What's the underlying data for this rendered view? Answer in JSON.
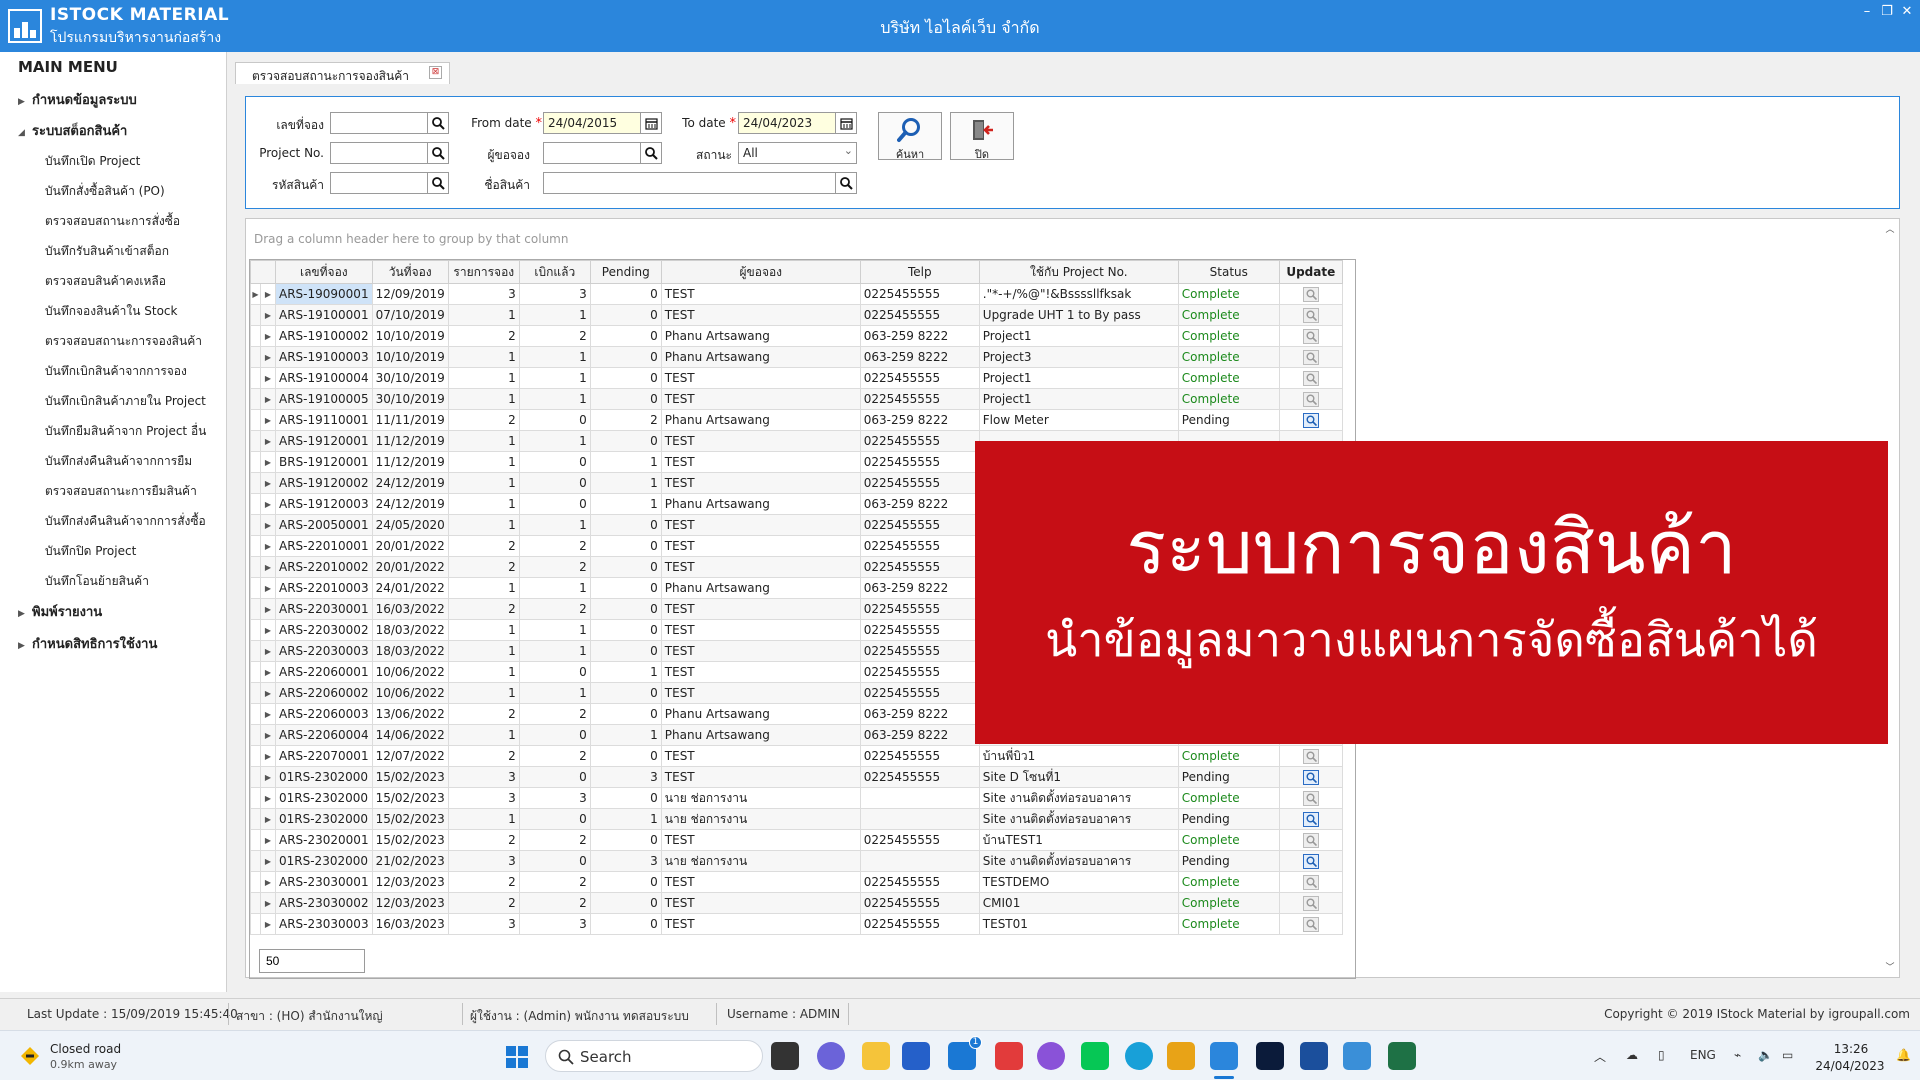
{
  "app": {
    "logo_name": "ISTOCK MATERIAL",
    "logo_subtitle": "โปรแกรมบริหารงานก่อสร้าง",
    "company": "บริษัท ไอไลค์เว็บ จำกัด",
    "win_min": "–",
    "win_restore": "❐",
    "win_close": "✕",
    "brand_color": "#2b86dc"
  },
  "sidebar": {
    "title": "MAIN MENU",
    "groups": [
      {
        "label": "กำหนดข้อมูลระบบ",
        "caret": "▶"
      },
      {
        "label": "ระบบสต็อกสินค้า",
        "caret": "◢"
      },
      {
        "label": "พิมพ์รายงาน",
        "caret": "▶"
      },
      {
        "label": "กำหนดสิทธิการใช้งาน",
        "caret": "▶"
      }
    ],
    "items": [
      "บันทึกเปิด Project",
      "บันทึกสั่งซื้อสินค้า (PO)",
      "ตรวจสอบสถานะการสั่งซื้อ",
      "บันทึกรับสินค้าเข้าสต็อก",
      "ตรวจสอบสินค้าคงเหลือ",
      "บันทึกจองสินค้าใน Stock",
      "ตรวจสอบสถานะการจองสินค้า",
      "บันทึกเบิกสินค้าจากการจอง",
      "บันทึกเบิกสินค้าภายใน Project",
      "บันทึกยืมสินค้าจาก Project อื่น",
      "บันทึกส่งคืนสินค้าจากการยืม",
      "ตรวจสอบสถานะการยืมสินค้า",
      "บันทึกส่งคืนสินค้าจากการสั่งซื้อ",
      "บันทึกปิด Project",
      "บันทึกโอนย้ายสินค้า"
    ]
  },
  "tab": {
    "label": "ตรวจสอบสถานะการจองสินค้า",
    "close": "⊠"
  },
  "filter": {
    "doc_no_label": "เลขที่จอง",
    "project_label": "Project No.",
    "product_code_label": "รหัสสินค้า",
    "from_date_label": "From date",
    "from_date_value": "24/04/2015",
    "to_date_label": "To date",
    "to_date_value": "24/04/2023",
    "requester_label": "ผู้ขอจอง",
    "product_name_label": "ชื่อสินค้า",
    "status_label": "สถานะ",
    "status_value": "All",
    "required_mark": "*",
    "search_label": "ค้นหา",
    "close_label": "ปิด"
  },
  "grid": {
    "group_hint": "Drag a column header here to group by that column",
    "columns": [
      "เลขที่จอง",
      "วันที่จอง",
      "รายการจอง",
      "เบิกแล้ว",
      "Pending",
      "ผู้ขอจอง",
      "Telp",
      "ใช้กับ Project No.",
      "Status",
      "Update"
    ],
    "current_row_marker": "▶",
    "expander": "▶",
    "rows": [
      {
        "doc": "ARS-19090001",
        "date": "12/09/2019",
        "items": "3",
        "issued": "3",
        "pending": "0",
        "req": "TEST",
        "tel": "0225455555",
        "proj": ".\"*-+/%@\"!&Bssssllfksak",
        "status": "Complete"
      },
      {
        "doc": "ARS-19100001",
        "date": "07/10/2019",
        "items": "1",
        "issued": "1",
        "pending": "0",
        "req": "TEST",
        "tel": "0225455555",
        "proj": "Upgrade UHT 1 to By pass",
        "status": "Complete"
      },
      {
        "doc": "ARS-19100002",
        "date": "10/10/2019",
        "items": "2",
        "issued": "2",
        "pending": "0",
        "req": "Phanu Artsawang",
        "tel": "063-259 8222",
        "proj": "Project1",
        "status": "Complete"
      },
      {
        "doc": "ARS-19100003",
        "date": "10/10/2019",
        "items": "1",
        "issued": "1",
        "pending": "0",
        "req": "Phanu Artsawang",
        "tel": "063-259 8222",
        "proj": "Project3",
        "status": "Complete"
      },
      {
        "doc": "ARS-19100004",
        "date": "30/10/2019",
        "items": "1",
        "issued": "1",
        "pending": "0",
        "req": "TEST",
        "tel": "0225455555",
        "proj": "Project1",
        "status": "Complete"
      },
      {
        "doc": "ARS-19100005",
        "date": "30/10/2019",
        "items": "1",
        "issued": "1",
        "pending": "0",
        "req": "TEST",
        "tel": "0225455555",
        "proj": "Project1",
        "status": "Complete"
      },
      {
        "doc": "ARS-19110001",
        "date": "11/11/2019",
        "items": "2",
        "issued": "0",
        "pending": "2",
        "req": "Phanu Artsawang",
        "tel": "063-259 8222",
        "proj": "Flow Meter",
        "status": "Pending"
      },
      {
        "doc": "ARS-19120001",
        "date": "11/12/2019",
        "items": "1",
        "issued": "1",
        "pending": "0",
        "req": "TEST",
        "tel": "0225455555",
        "proj": "",
        "status": ""
      },
      {
        "doc": "BRS-19120001",
        "date": "11/12/2019",
        "items": "1",
        "issued": "0",
        "pending": "1",
        "req": "TEST",
        "tel": "0225455555",
        "proj": "",
        "status": ""
      },
      {
        "doc": "ARS-19120002",
        "date": "24/12/2019",
        "items": "1",
        "issued": "0",
        "pending": "1",
        "req": "TEST",
        "tel": "0225455555",
        "proj": "",
        "status": ""
      },
      {
        "doc": "ARS-19120003",
        "date": "24/12/2019",
        "items": "1",
        "issued": "0",
        "pending": "1",
        "req": "Phanu Artsawang",
        "tel": "063-259 8222",
        "proj": "",
        "status": ""
      },
      {
        "doc": "ARS-20050001",
        "date": "24/05/2020",
        "items": "1",
        "issued": "1",
        "pending": "0",
        "req": "TEST",
        "tel": "0225455555",
        "proj": "",
        "status": ""
      },
      {
        "doc": "ARS-22010001",
        "date": "20/01/2022",
        "items": "2",
        "issued": "2",
        "pending": "0",
        "req": "TEST",
        "tel": "0225455555",
        "proj": "",
        "status": ""
      },
      {
        "doc": "ARS-22010002",
        "date": "20/01/2022",
        "items": "2",
        "issued": "2",
        "pending": "0",
        "req": "TEST",
        "tel": "0225455555",
        "proj": "",
        "status": ""
      },
      {
        "doc": "ARS-22010003",
        "date": "24/01/2022",
        "items": "1",
        "issued": "1",
        "pending": "0",
        "req": "Phanu Artsawang",
        "tel": "063-259 8222",
        "proj": "",
        "status": ""
      },
      {
        "doc": "ARS-22030001",
        "date": "16/03/2022",
        "items": "2",
        "issued": "2",
        "pending": "0",
        "req": "TEST",
        "tel": "0225455555",
        "proj": "",
        "status": ""
      },
      {
        "doc": "ARS-22030002",
        "date": "18/03/2022",
        "items": "1",
        "issued": "1",
        "pending": "0",
        "req": "TEST",
        "tel": "0225455555",
        "proj": "",
        "status": ""
      },
      {
        "doc": "ARS-22030003",
        "date": "18/03/2022",
        "items": "1",
        "issued": "1",
        "pending": "0",
        "req": "TEST",
        "tel": "0225455555",
        "proj": "",
        "status": ""
      },
      {
        "doc": "ARS-22060001",
        "date": "10/06/2022",
        "items": "1",
        "issued": "0",
        "pending": "1",
        "req": "TEST",
        "tel": "0225455555",
        "proj": "",
        "status": ""
      },
      {
        "doc": "ARS-22060002",
        "date": "10/06/2022",
        "items": "1",
        "issued": "1",
        "pending": "0",
        "req": "TEST",
        "tel": "0225455555",
        "proj": "",
        "status": ""
      },
      {
        "doc": "ARS-22060003",
        "date": "13/06/2022",
        "items": "2",
        "issued": "2",
        "pending": "0",
        "req": "Phanu Artsawang",
        "tel": "063-259 8222",
        "proj": "",
        "status": ""
      },
      {
        "doc": "ARS-22060004",
        "date": "14/06/2022",
        "items": "1",
        "issued": "0",
        "pending": "1",
        "req": "Phanu Artsawang",
        "tel": "063-259 8222",
        "proj": "",
        "status": ""
      },
      {
        "doc": "ARS-22070001",
        "date": "12/07/2022",
        "items": "2",
        "issued": "2",
        "pending": "0",
        "req": "TEST",
        "tel": "0225455555",
        "proj": "บ้านพี่บิว1",
        "status": "Complete"
      },
      {
        "doc": "01RS-2302000",
        "date": "15/02/2023",
        "items": "3",
        "issued": "0",
        "pending": "3",
        "req": "TEST",
        "tel": "0225455555",
        "proj": "Site D โซนที่1",
        "status": "Pending"
      },
      {
        "doc": "01RS-2302000",
        "date": "15/02/2023",
        "items": "3",
        "issued": "3",
        "pending": "0",
        "req": "นาย ช่อการงาน",
        "tel": "",
        "proj": "Site งานติดตั้งท่อรอบอาคาร",
        "status": "Complete"
      },
      {
        "doc": "01RS-2302000",
        "date": "15/02/2023",
        "items": "1",
        "issued": "0",
        "pending": "1",
        "req": "นาย ช่อการงาน",
        "tel": "",
        "proj": "Site งานติดตั้งท่อรอบอาคาร",
        "status": "Pending"
      },
      {
        "doc": "ARS-23020001",
        "date": "15/02/2023",
        "items": "2",
        "issued": "2",
        "pending": "0",
        "req": "TEST",
        "tel": "0225455555",
        "proj": "บ้านTEST1",
        "status": "Complete"
      },
      {
        "doc": "01RS-2302000",
        "date": "21/02/2023",
        "items": "3",
        "issued": "0",
        "pending": "3",
        "req": "นาย ช่อการงาน",
        "tel": "",
        "proj": "Site งานติดตั้งท่อรอบอาคาร",
        "status": "Pending"
      },
      {
        "doc": "ARS-23030001",
        "date": "12/03/2023",
        "items": "2",
        "issued": "2",
        "pending": "0",
        "req": "TEST",
        "tel": "0225455555",
        "proj": "TESTDEMO",
        "status": "Complete"
      },
      {
        "doc": "ARS-23030002",
        "date": "12/03/2023",
        "items": "2",
        "issued": "2",
        "pending": "0",
        "req": "TEST",
        "tel": "0225455555",
        "proj": "CMI01",
        "status": "Complete"
      },
      {
        "doc": "ARS-23030003",
        "date": "16/03/2023",
        "items": "3",
        "issued": "3",
        "pending": "0",
        "req": "TEST",
        "tel": "0225455555",
        "proj": "TEST01",
        "status": "Complete"
      }
    ],
    "page_size": "50",
    "complete_color": "#1c8a1c"
  },
  "promo": {
    "title": "ระบบการจองสินค้า",
    "subtitle": "นำข้อมูลมาวางแผนการจัดซื้อสินค้าได้",
    "bg_color": "#c60e15"
  },
  "statusbar": {
    "last_update": "Last Update : 15/09/2019 15:45:40",
    "branch": "สาขา : (HO) สำนักงานใหญ่",
    "user": "ผู้ใช้งาน : (Admin) พนักงาน ทดสอบระบบ",
    "username": "Username : ADMIN",
    "copyright": "Copyright © 2019 IStock Material by igroupall.com"
  },
  "taskbar": {
    "weather_title": "Closed road",
    "weather_sub": "0.9km away",
    "search_placeholder": "Search",
    "mail_badge": "1",
    "lang": "ENG",
    "time": "13:26",
    "date": "24/04/2023"
  }
}
